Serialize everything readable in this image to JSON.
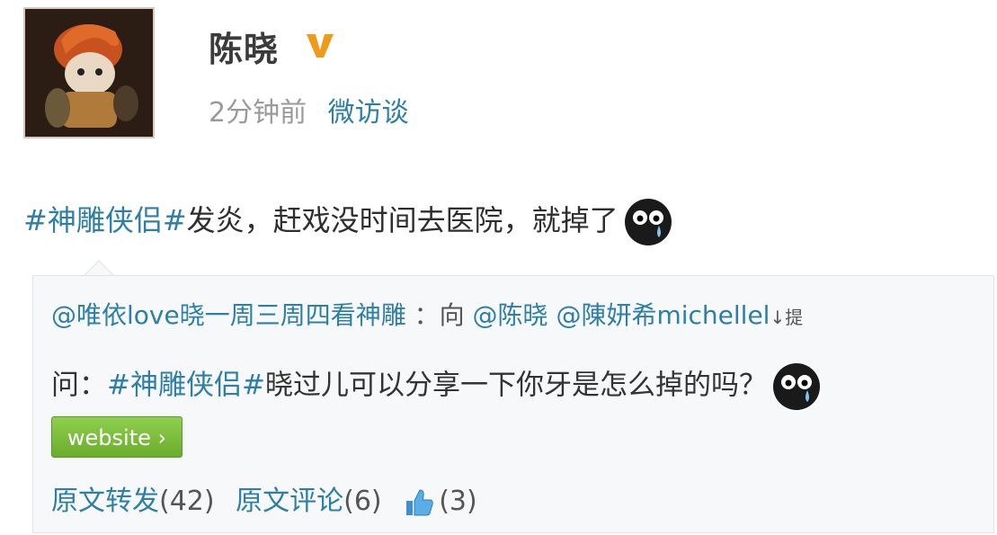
{
  "author": {
    "name": "陈晓",
    "verified_icon": "verified-v-icon",
    "time": "2分钟前",
    "source": "微访谈"
  },
  "post": {
    "topic": "#神雕侠侣#",
    "text": "发炎，赶戏没时间去医院，就掉了"
  },
  "repost": {
    "asker": "@唯依love晓一周三周四看神雕",
    "sep": "：向",
    "mention1": "@陈晓",
    "mention2": "@陳妍希michellel",
    "tail": "↓提",
    "question_prefix": "问：",
    "question_topic": "#神雕侠侣#",
    "question_text": "晓过儿可以分享一下你牙是怎么掉的吗？",
    "website_button": "website ›",
    "forward_label": "原文转发",
    "forward_count": "(42)",
    "comment_label": "原文评论",
    "comment_count": "(6)",
    "like_count": "(3)"
  },
  "colors": {
    "link": "#2d7fa6",
    "button_green": "#6aac2c",
    "verified_orange": "#f09a1a"
  }
}
